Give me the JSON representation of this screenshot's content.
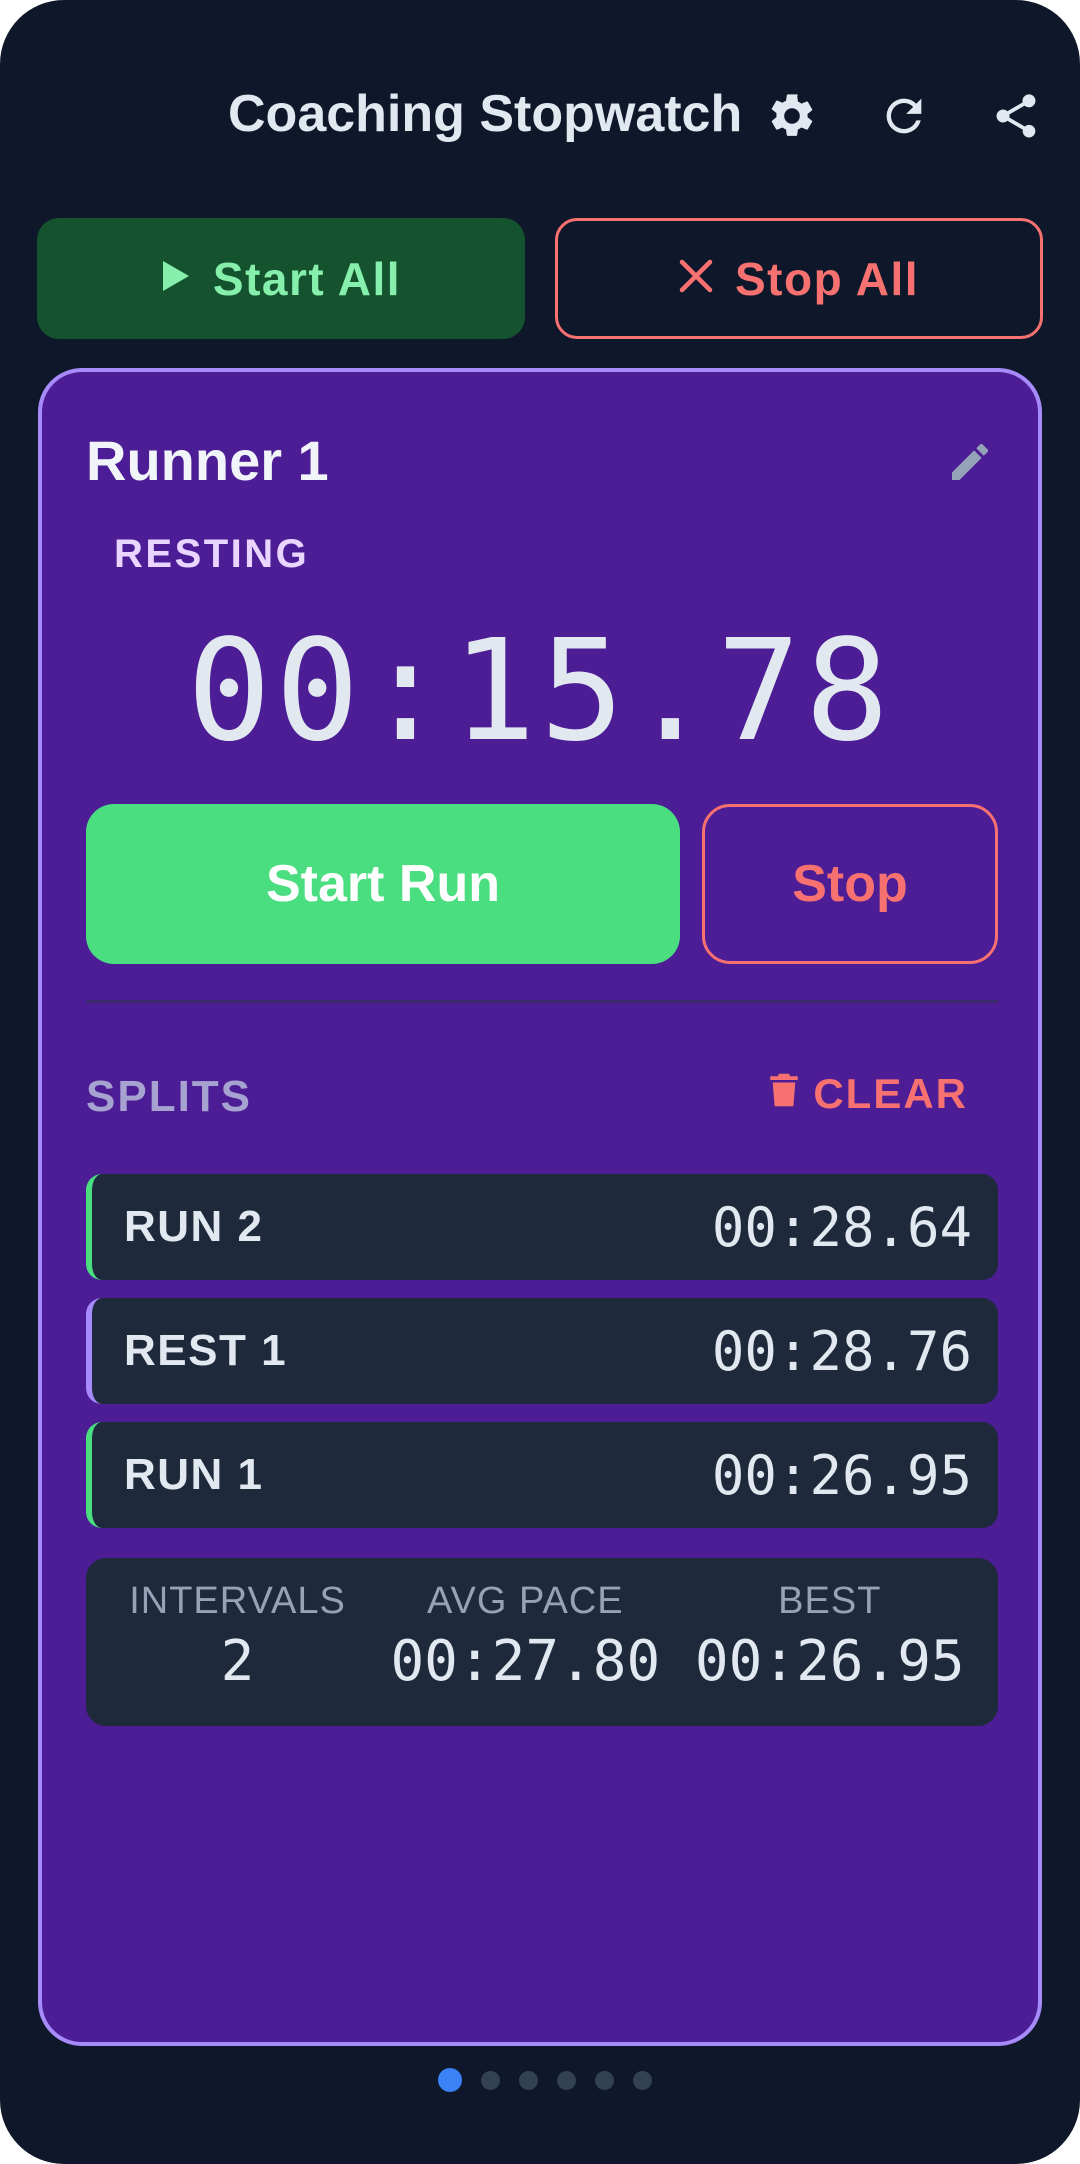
{
  "header": {
    "title": "Coaching Stopwatch",
    "icons": [
      "gear-icon",
      "refresh-icon",
      "share-icon"
    ]
  },
  "top_actions": {
    "start_all": "Start All",
    "stop_all": "Stop All"
  },
  "runner": {
    "name": "Runner 1",
    "status": "RESTING",
    "timer": "00:15.78",
    "start_run": "Start Run",
    "stop": "Stop"
  },
  "splits": {
    "title": "SPLITS",
    "clear_label": "CLEAR",
    "items": [
      {
        "label": "RUN 2",
        "time": "00:28.64",
        "kind": "run"
      },
      {
        "label": "REST 1",
        "time": "00:28.76",
        "kind": "rest"
      },
      {
        "label": "RUN 1",
        "time": "00:26.95",
        "kind": "run"
      }
    ]
  },
  "stats": {
    "intervals_label": "INTERVALS",
    "intervals_value": "2",
    "avg_pace_label": "AVG PACE",
    "avg_pace_value": "00:27.80",
    "best_label": "BEST",
    "best_value": "00:26.95"
  },
  "pager": {
    "count": 6,
    "active_index": 0
  },
  "colors": {
    "background": "#0f172a",
    "card": "#4c1d95",
    "card_border": "#a78bfa",
    "start": "#4ade80",
    "start_all_bg": "#14532d",
    "stop": "#f87171",
    "run_accent": "#4ade80",
    "rest_accent": "#a78bfa",
    "page_dot_active": "#3b82f6"
  }
}
